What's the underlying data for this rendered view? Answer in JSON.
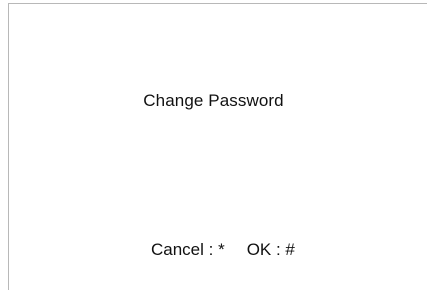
{
  "dialog": {
    "title": "Change Password",
    "cancel_hint": "Cancel : *",
    "ok_hint": "OK : #"
  }
}
